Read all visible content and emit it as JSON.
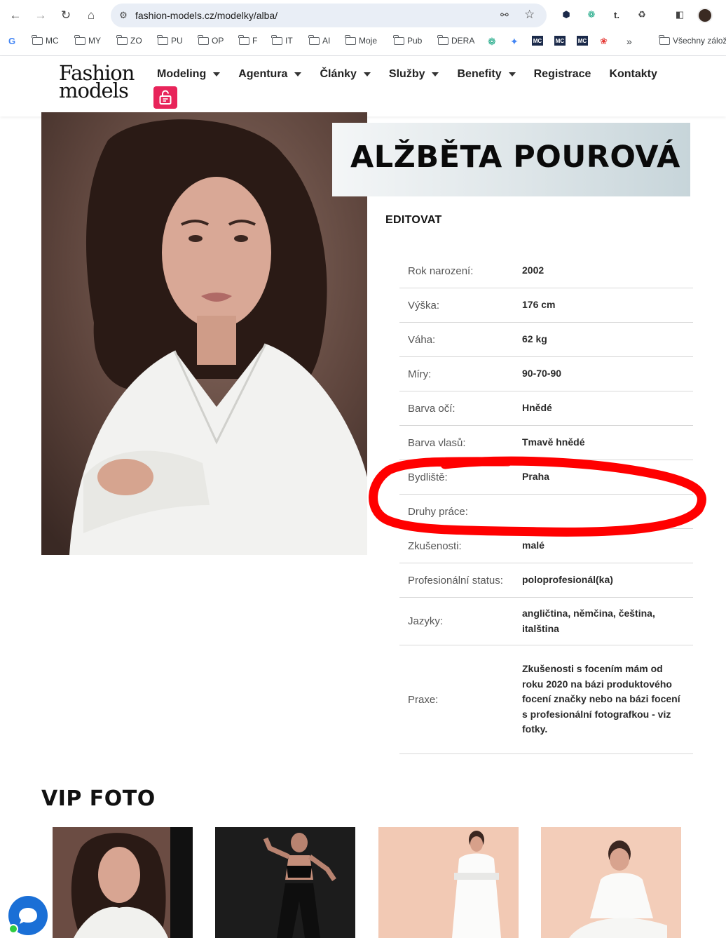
{
  "browser": {
    "url": "fashion-models.cz/modelky/alba/",
    "bookmarks": [
      "MC",
      "MY",
      "ZO",
      "PU",
      "OP",
      "F",
      "IT",
      "AI",
      "Moje",
      "Pub",
      "DERA",
      "Všechny zálož"
    ],
    "overflow_label": "»",
    "mc_badge": "MC"
  },
  "site": {
    "logo_line1": "Fashion",
    "logo_line2": "models",
    "menu": [
      "Modeling",
      "Agentura",
      "Články",
      "Služby",
      "Benefity",
      "Registrace",
      "Kontakty"
    ]
  },
  "profile": {
    "name": "ALŽBĚTA POUROVÁ",
    "edit_label": "EDITOVAT",
    "rows": [
      {
        "label": "Rok narození:",
        "value": "2002"
      },
      {
        "label": "Výška:",
        "value": "176 cm"
      },
      {
        "label": "Váha:",
        "value": "62 kg"
      },
      {
        "label": "Míry:",
        "value": "90-70-90"
      },
      {
        "label": "Barva očí:",
        "value": "Hnědé"
      },
      {
        "label": "Barva vlasů:",
        "value": "Tmavě hnědé"
      },
      {
        "label": "Bydliště:",
        "value": "Praha"
      },
      {
        "label": "Druhy práce:",
        "value": ""
      },
      {
        "label": "Zkušenosti:",
        "value": "malé"
      },
      {
        "label": "Profesionální status:",
        "value": "poloprofesionál(ka)"
      },
      {
        "label": "Jazyky:",
        "value": "angličtina, němčina, čeština, italština"
      },
      {
        "label": "Praxe:",
        "value": "Zkušenosti s focením mám od roku 2020 na bázi produktového focení značky nebo na bázi focení s profesionální fotografkou - viz fotky."
      }
    ]
  },
  "vip": {
    "title": "VIP FOTO"
  },
  "colors": {
    "accent": "#e8245a",
    "annotation": "#ff0000",
    "chat": "#1a6fd6"
  }
}
